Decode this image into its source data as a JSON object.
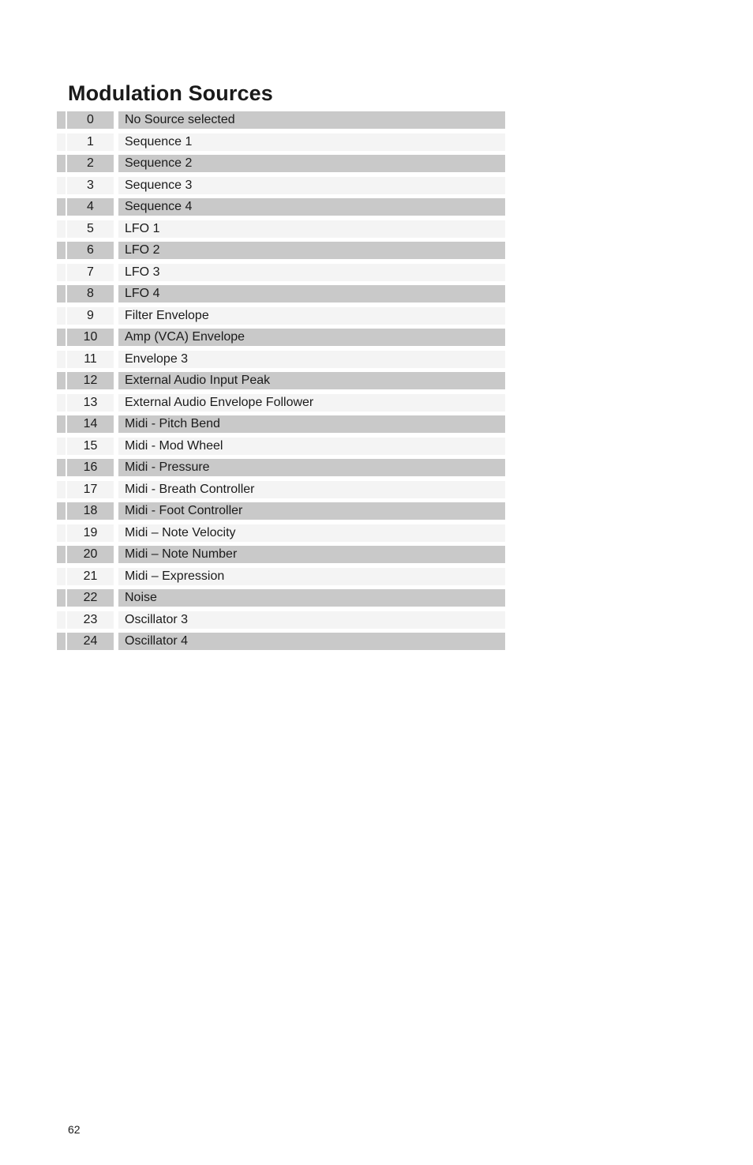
{
  "document": {
    "title": "Modulation Sources",
    "page_number": "62"
  },
  "table": {
    "rows": [
      {
        "index": "0",
        "label": "No Source selected"
      },
      {
        "index": "1",
        "label": "Sequence 1"
      },
      {
        "index": "2",
        "label": "Sequence 2"
      },
      {
        "index": "3",
        "label": "Sequence 3"
      },
      {
        "index": "4",
        "label": "Sequence 4"
      },
      {
        "index": "5",
        "label": "LFO 1"
      },
      {
        "index": "6",
        "label": "LFO 2"
      },
      {
        "index": "7",
        "label": "LFO 3"
      },
      {
        "index": "8",
        "label": "LFO 4"
      },
      {
        "index": "9",
        "label": "Filter Envelope"
      },
      {
        "index": "10",
        "label": "Amp (VCA) Envelope"
      },
      {
        "index": "11",
        "label": "Envelope 3"
      },
      {
        "index": "12",
        "label": "External Audio Input Peak"
      },
      {
        "index": "13",
        "label": "External Audio Envelope Follower"
      },
      {
        "index": "14",
        "label": "Midi - Pitch Bend"
      },
      {
        "index": "15",
        "label": "Midi - Mod Wheel"
      },
      {
        "index": "16",
        "label": "Midi - Pressure"
      },
      {
        "index": "17",
        "label": "Midi - Breath Controller"
      },
      {
        "index": "18",
        "label": "Midi - Foot Controller"
      },
      {
        "index": "19",
        "label": "Midi – Note Velocity"
      },
      {
        "index": "20",
        "label": "Midi – Note Number"
      },
      {
        "index": "21",
        "label": "Midi – Expression"
      },
      {
        "index": "22",
        "label": "Noise"
      },
      {
        "index": "23",
        "label": "Oscillator 3"
      },
      {
        "index": "24",
        "label": "Oscillator 4"
      }
    ]
  },
  "colors": {
    "band_dark": "#c9c9c9",
    "band_light": "#f4f4f4",
    "text": "#1b1b1b",
    "page_background": "#ffffff"
  }
}
